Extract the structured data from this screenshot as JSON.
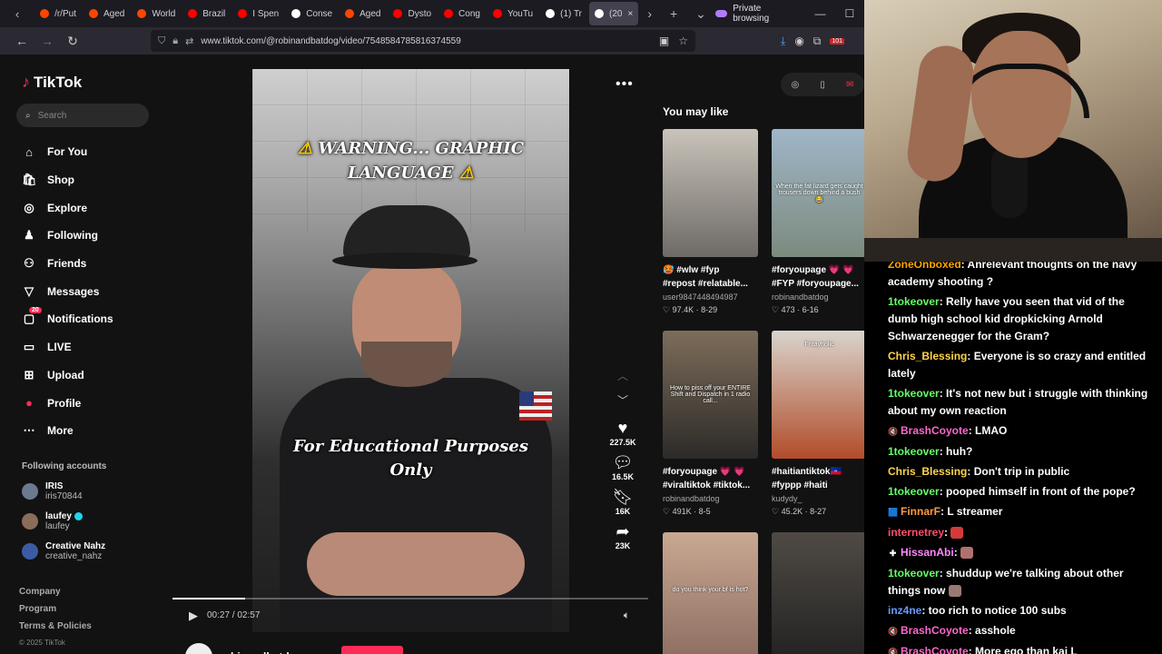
{
  "browser": {
    "tabs": [
      {
        "label": "/r/Put",
        "color": "#ff4500"
      },
      {
        "label": "Aged",
        "color": "#ff4500"
      },
      {
        "label": "World",
        "color": "#ff4500"
      },
      {
        "label": "Brazil",
        "color": "#ff0000"
      },
      {
        "label": "I Spen",
        "color": "#ff0000"
      },
      {
        "label": "Conse",
        "color": "#ffffff"
      },
      {
        "label": "Aged",
        "color": "#ff4500"
      },
      {
        "label": "Dysto",
        "color": "#ff0000"
      },
      {
        "label": "Cong",
        "color": "#ff0000"
      },
      {
        "label": "YouTu",
        "color": "#ff0000"
      },
      {
        "label": "(1) Tr",
        "color": "#ffffff"
      },
      {
        "label": "(20",
        "color": "#ffffff",
        "active": true
      }
    ],
    "private_label": "Private browsing",
    "url": "www.tiktok.com/@robinandbatdog/video/7548584785816374559",
    "ext_badge": "101"
  },
  "sidebar": {
    "logo_text": "TikTok",
    "search_placeholder": "Search",
    "items": [
      {
        "label": "For You",
        "icon": "home-icon"
      },
      {
        "label": "Shop",
        "icon": "shop-icon"
      },
      {
        "label": "Explore",
        "icon": "compass-icon"
      },
      {
        "label": "Following",
        "icon": "following-icon"
      },
      {
        "label": "Friends",
        "icon": "friends-icon"
      },
      {
        "label": "Messages",
        "icon": "messages-icon"
      },
      {
        "label": "Notifications",
        "icon": "notifications-icon",
        "badge": "20"
      },
      {
        "label": "LIVE",
        "icon": "live-icon"
      },
      {
        "label": "Upload",
        "icon": "upload-icon"
      },
      {
        "label": "Profile",
        "icon": "profile-icon"
      },
      {
        "label": "More",
        "icon": "more-icon"
      }
    ],
    "following_title": "Following accounts",
    "accounts": [
      {
        "name": "IRIS",
        "handle": "iris70844",
        "color": "#6b7a8f"
      },
      {
        "name": "laufey",
        "handle": "laufey",
        "color": "#8a6c5a",
        "verified": true
      },
      {
        "name": "Creative Nahz",
        "handle": "creative_nahz",
        "color": "#3b5ba5"
      }
    ],
    "footer": [
      "Company",
      "Program",
      "Terms & Policies"
    ],
    "copyright": "© 2025 TikTok"
  },
  "video": {
    "overlay_top_line1": "WARNING... GRAPHIC",
    "overlay_top_line2": "LANGUAGE",
    "overlay_bottom_line1": "For Educational Purposes",
    "overlay_bottom_line2": "Only",
    "time": "00:27 / 02:57",
    "progress": 0.153,
    "creator": "robinandbatdog"
  },
  "actions": [
    {
      "icon": "heart-icon",
      "count": "227.5K"
    },
    {
      "icon": "comment-icon",
      "count": "16.5K"
    },
    {
      "icon": "bookmark-icon",
      "count": "16K"
    },
    {
      "icon": "share-icon",
      "count": "23K"
    }
  ],
  "recommendations": {
    "title": "You may like",
    "items": [
      {
        "title": "🥵 #wlw #fyp",
        "title2": "#repost #relatable...",
        "author": "user9847448494987",
        "likes": "97.4K",
        "date": "8-29",
        "bg1": "#c9c3ba",
        "bg2": "#6e6a66",
        "caption": ""
      },
      {
        "title": "#foryoupage 💗 💗",
        "title2": "#FYP #foryoupage...",
        "author": "robinandbatdog",
        "likes": "473",
        "date": "6-16",
        "bg1": "#9fb6c8",
        "bg2": "#7c8a7e",
        "caption": "When the fat lizard gets caught trousers down behind a bush 😂"
      },
      {
        "title": "#foryoupage 💗 💗",
        "title2": "#viraltiktok #tiktok...",
        "author": "robinandbatdog",
        "likes": "491K",
        "date": "8-5",
        "bg1": "#7d6d5a",
        "bg2": "#2c2a28",
        "caption": "How to piss off your ENTIRE Shift and Dispatch in 1 radio call..."
      },
      {
        "title": "#haitiantiktok🇭🇹",
        "title2": "#fyppp #haiti",
        "author": "kudydy_",
        "likes": "45.2K",
        "date": "8-27",
        "bg1": "#d9d4cc",
        "bg2": "#b14c2a",
        "caption": "Fritayholic"
      },
      {
        "title": "",
        "title2": "",
        "author": "",
        "likes": "",
        "date": "",
        "bg1": "#c9a892",
        "bg2": "#8c6d60",
        "caption": "do you think your bf is hot?"
      },
      {
        "title": "",
        "title2": "",
        "author": "",
        "likes": "",
        "date": "",
        "bg1": "#4f4a44",
        "bg2": "#222222",
        "caption": ""
      }
    ]
  },
  "chat": [
    {
      "user": "ZoneOnboxed",
      "color": "#ffa500",
      "text": ": Anrelevant thoughts on the navy academy shooting ?",
      "badge": ""
    },
    {
      "user": "1tokeover",
      "color": "#66ff66",
      "text": ": Relly have you seen that vid of the dumb high school kid dropkicking Arnold Schwarzenegger for the Gram?",
      "badge": ""
    },
    {
      "user": "Chris_Blessing",
      "color": "#ffd44d",
      "text": ": Everyone is so crazy and entitled lately",
      "badge": ""
    },
    {
      "user": "1tokeover",
      "color": "#66ff66",
      "text": ": It's not new but i struggle with thinking about my own reaction",
      "badge": ""
    },
    {
      "user": "BrashCoyote",
      "color": "#ff66cc",
      "text": ": LMAO",
      "badge": "🔇"
    },
    {
      "user": "1tokeover",
      "color": "#66ff66",
      "text": ": huh?",
      "badge": ""
    },
    {
      "user": "Chris_Blessing",
      "color": "#ffd44d",
      "text": ": Don't trip in public",
      "badge": ""
    },
    {
      "user": "1tokeover",
      "color": "#66ff66",
      "text": ": pooped himself in front of the pope?",
      "badge": ""
    },
    {
      "user": "FinnarF",
      "color": "#ff9944",
      "text": ": L streamer",
      "badge": "🟦"
    },
    {
      "user": "internetrey",
      "color": "#ff4d6d",
      "text": ":",
      "badge": "",
      "emote": "#d43a3a"
    },
    {
      "user": "HissanAbi",
      "color": "#ff88ff",
      "text": ":",
      "badge": "✚",
      "emote": "#b07070"
    },
    {
      "user": "1tokeover",
      "color": "#66ff66",
      "text": ": shuddup we're talking about other things now",
      "badge": "",
      "emote": "#9a7a70"
    },
    {
      "user": "inz4ne",
      "color": "#6699ff",
      "text": ": too rich to notice 100 subs",
      "badge": ""
    },
    {
      "user": "BrashCoyote",
      "color": "#ff66cc",
      "text": ": asshole",
      "badge": "🔇"
    },
    {
      "user": "BrashCoyote",
      "color": "#ff66cc",
      "text": ": More ego than kai L",
      "badge": "🔇"
    }
  ]
}
